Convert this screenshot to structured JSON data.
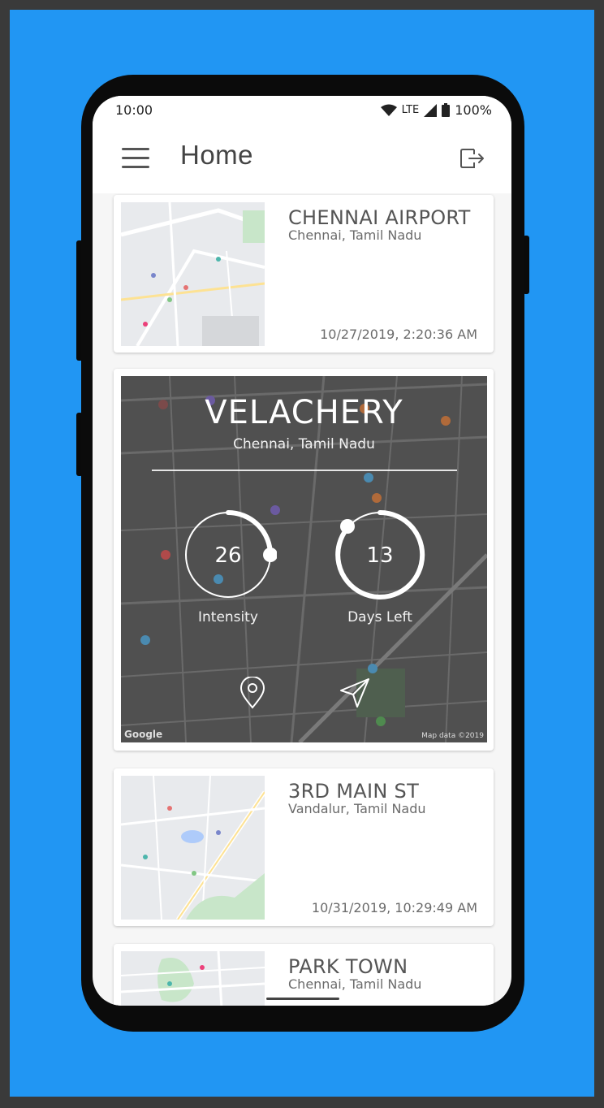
{
  "status_bar": {
    "time": "10:00",
    "network": "LTE",
    "battery": "100%"
  },
  "app_bar": {
    "title": "Home"
  },
  "colors": {
    "background": "#2196f3",
    "card_title": "#555555",
    "overlay_text": "#ffffff"
  },
  "cards": [
    {
      "title": "CHENNAI AIRPORT",
      "subtitle": "Chennai, Tamil Nadu",
      "timestamp": "10/27/2019, 2:20:36 AM"
    },
    {
      "title": "3RD MAIN ST",
      "subtitle": "Vandalur, Tamil Nadu",
      "timestamp": "10/31/2019, 10:29:49 AM"
    },
    {
      "title": "PARK TOWN",
      "subtitle": "Chennai, Tamil Nadu"
    }
  ],
  "featured": {
    "title": "VELACHERY",
    "subtitle": "Chennai, Tamil Nadu",
    "intensity": {
      "value": "26",
      "label": "Intensity"
    },
    "days_left": {
      "value": "13",
      "label": "Days Left"
    },
    "map_credit": "Map data ©2019"
  }
}
